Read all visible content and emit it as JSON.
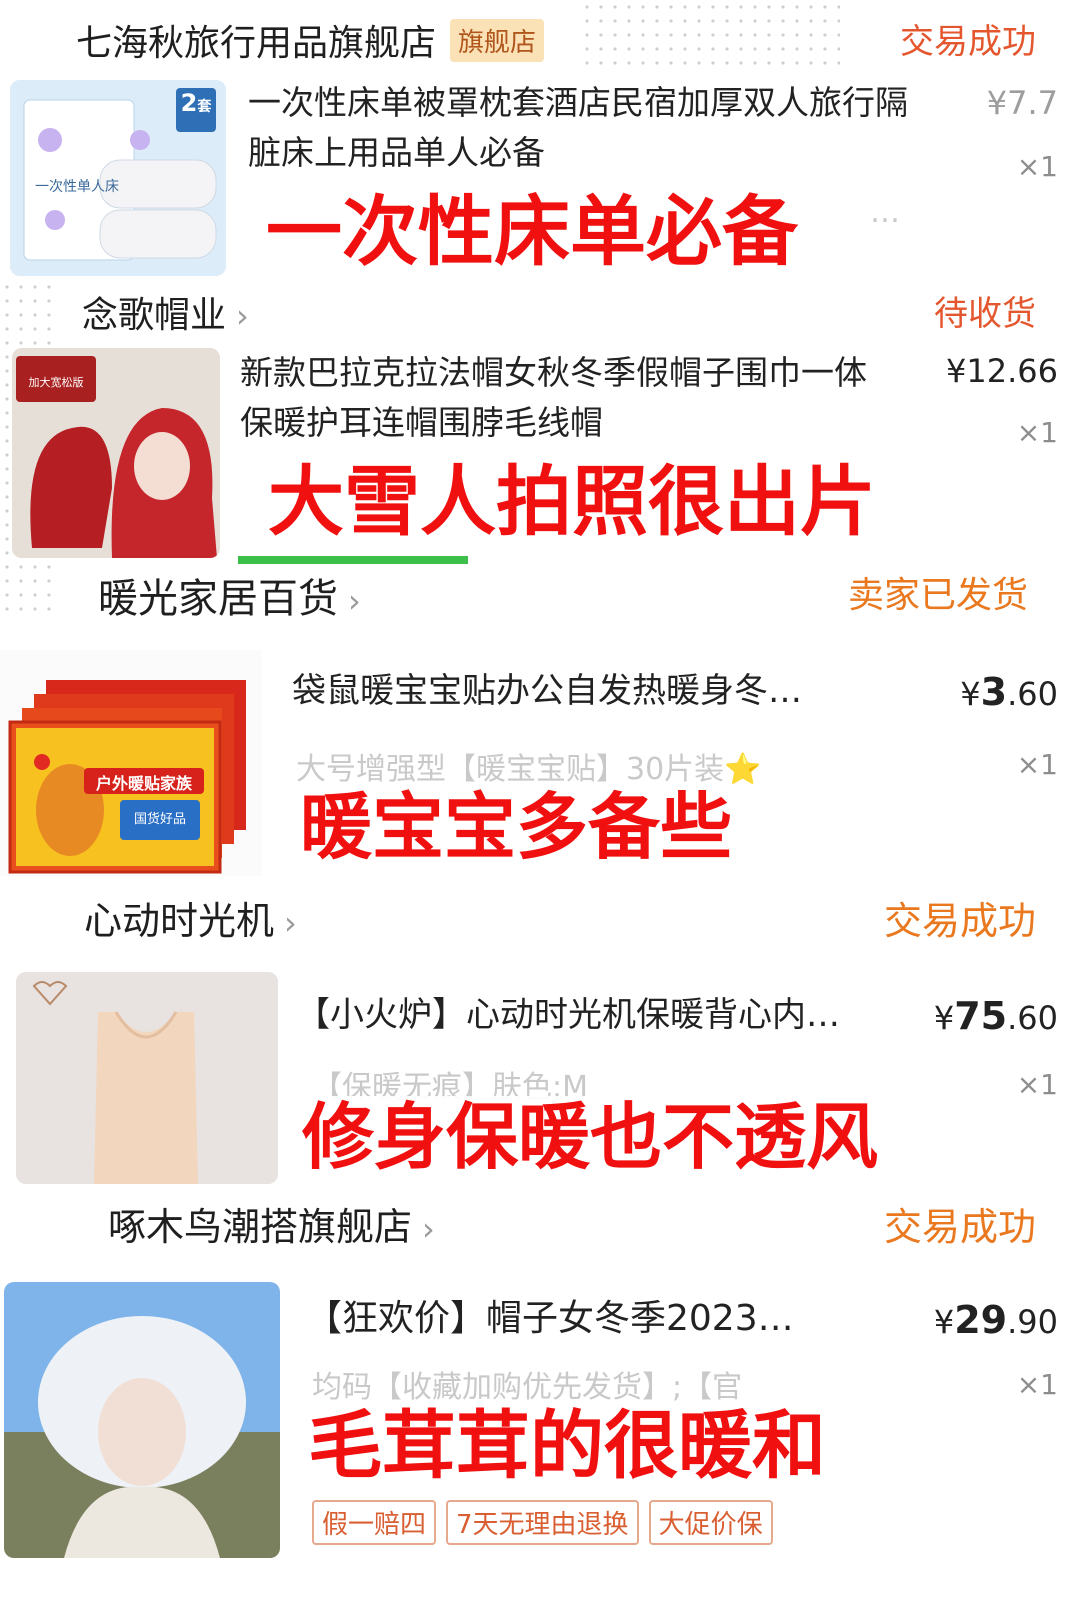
{
  "orders": [
    {
      "shop": "七海秋旅行用品旗舰店",
      "badge": "旗舰店",
      "status": "交易成功",
      "title": "一次性床单被罩枕套酒店民宿加厚双人旅行隔脏床上用品单人必备",
      "price": "¥7.7",
      "qty": "×1",
      "spec": "…",
      "caption": "一次性床单必备",
      "thumb_label": "一次性单人床",
      "thumb_badge": "2",
      "thumb_badge_sub": "套"
    },
    {
      "shop": "念歌帽业",
      "status": "待收货",
      "title": "新款巴拉克拉法帽女秋冬季假帽子围巾一体保暖护耳连帽围脖毛线帽",
      "price": "¥12.66",
      "qty": "×1",
      "caption": "大雪人拍照很出片",
      "thumb_label": "加大宽松版"
    },
    {
      "shop": "暖光家居百货",
      "status": "卖家已发货",
      "title": "袋鼠暖宝宝贴办公自发热暖身冬…",
      "price_symbol": "¥",
      "price_int": "3",
      "price_dec": ".60",
      "spec": "大号增强型【暖宝宝贴】30片装⭐",
      "qty": "×1",
      "caption": "暖宝宝多备些",
      "thumb_label": "户外暖贴家族",
      "thumb_sub": "国货好品"
    },
    {
      "shop": "心动时光机",
      "status": "交易成功",
      "title": "【小火炉】心动时光机保暖背心内…",
      "price_symbol": "¥",
      "price_int": "75",
      "price_dec": ".60",
      "spec": "【保暖无痕】肤色;M",
      "qty": "×1",
      "caption": "修身保暖也不透风"
    },
    {
      "shop": "啄木鸟潮搭旗舰店",
      "status": "交易成功",
      "title": "【狂欢价】帽子女冬季2023…",
      "price_symbol": "¥",
      "price_int": "29",
      "price_dec": ".90",
      "spec": "均码【收藏加购优先发货】;【官",
      "qty": "×1",
      "caption": "毛茸茸的很暖和",
      "tags": [
        "假一赔四",
        "7天无理由退换",
        "大促价保"
      ]
    }
  ],
  "colors": {
    "caption_red": "#f01010",
    "status_red": "#e4572e",
    "status_orange": "#e9781f"
  }
}
